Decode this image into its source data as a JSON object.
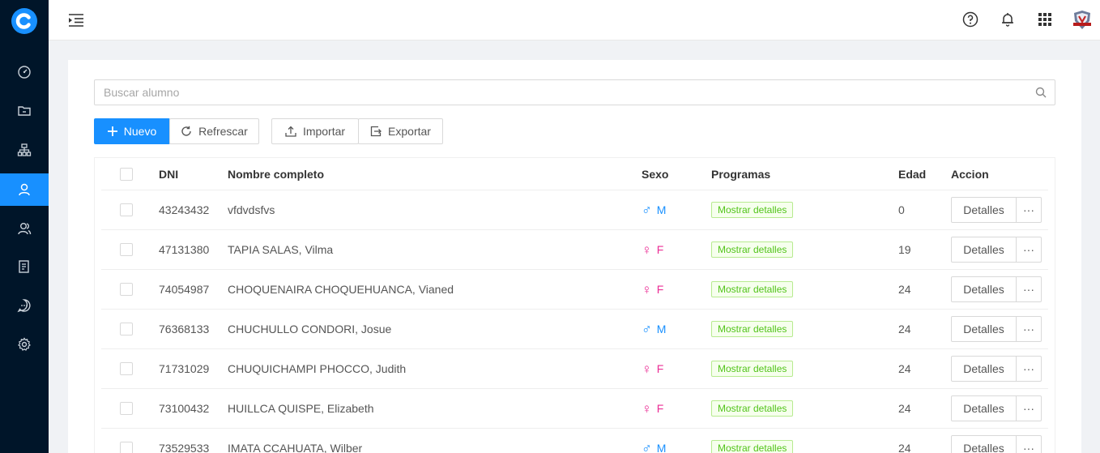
{
  "brand": {
    "logo_letter": "C",
    "accent": "#1890ff",
    "sidebar_bg": "#001529"
  },
  "sidebar": {
    "items": [
      {
        "name": "dashboard-icon",
        "active": false
      },
      {
        "name": "folder-icon",
        "active": false
      },
      {
        "name": "hierarchy-icon",
        "active": false
      },
      {
        "name": "user-icon",
        "active": true
      },
      {
        "name": "users-icon",
        "active": false
      },
      {
        "name": "report-icon",
        "active": false
      },
      {
        "name": "message-icon",
        "active": false
      },
      {
        "name": "settings-icon",
        "active": false
      }
    ]
  },
  "topbar": {
    "icons": [
      "menu-toggle-icon",
      "help-icon",
      "bell-icon",
      "apps-grid-icon",
      "avatar"
    ]
  },
  "search": {
    "placeholder": "Buscar alumno",
    "value": ""
  },
  "toolbar": {
    "new_label": "Nuevo",
    "refresh_label": "Refrescar",
    "import_label": "Importar",
    "export_label": "Exportar"
  },
  "table": {
    "headers": {
      "dni": "DNI",
      "name": "Nombre completo",
      "sex": "Sexo",
      "programs": "Programas",
      "age": "Edad",
      "action": "Accion"
    },
    "rows": [
      {
        "dni": "43243432",
        "name": "vfdvdsfvs",
        "sex": "M",
        "sex_symbol": "♂",
        "programs": "Mostrar detalles",
        "age": "0",
        "action": "Detalles",
        "more": "···"
      },
      {
        "dni": "47131380",
        "name": "TAPIA SALAS, Vilma",
        "sex": "F",
        "sex_symbol": "♀",
        "programs": "Mostrar detalles",
        "age": "19",
        "action": "Detalles",
        "more": "···"
      },
      {
        "dni": "74054987",
        "name": "CHOQUENAIRA CHOQUEHUANCA, Vianed",
        "sex": "F",
        "sex_symbol": "♀",
        "programs": "Mostrar detalles",
        "age": "24",
        "action": "Detalles",
        "more": "···"
      },
      {
        "dni": "76368133",
        "name": "CHUCHULLO CONDORI, Josue",
        "sex": "M",
        "sex_symbol": "♂",
        "programs": "Mostrar detalles",
        "age": "24",
        "action": "Detalles",
        "more": "···"
      },
      {
        "dni": "71731029",
        "name": "CHUQUICHAMPI PHOCCO, Judith",
        "sex": "F",
        "sex_symbol": "♀",
        "programs": "Mostrar detalles",
        "age": "24",
        "action": "Detalles",
        "more": "···"
      },
      {
        "dni": "73100432",
        "name": "HUILLCA QUISPE, Elizabeth",
        "sex": "F",
        "sex_symbol": "♀",
        "programs": "Mostrar detalles",
        "age": "24",
        "action": "Detalles",
        "more": "···"
      },
      {
        "dni": "73529533",
        "name": "IMATA CCAHUATA, Wilber",
        "sex": "M",
        "sex_symbol": "♂",
        "programs": "Mostrar detalles",
        "age": "24",
        "action": "Detalles",
        "more": "···"
      }
    ]
  }
}
